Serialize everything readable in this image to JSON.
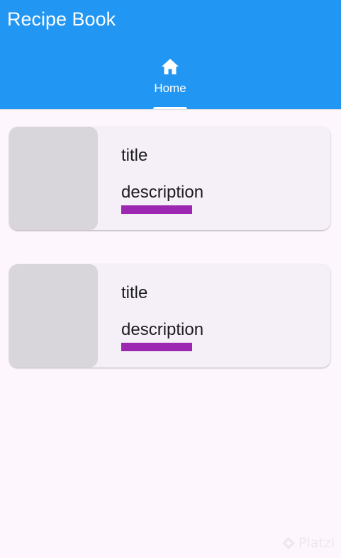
{
  "app_bar": {
    "title": "Recipe Book",
    "background": "#2196f3"
  },
  "tabs": [
    {
      "label": "Home",
      "icon": "home-icon",
      "selected": true
    }
  ],
  "recipes": [
    {
      "title": "title",
      "description": "description",
      "accent": "#9c27b0"
    },
    {
      "title": "title",
      "description": "description",
      "accent": "#9c27b0"
    }
  ],
  "watermark": {
    "text": "Platzi"
  }
}
